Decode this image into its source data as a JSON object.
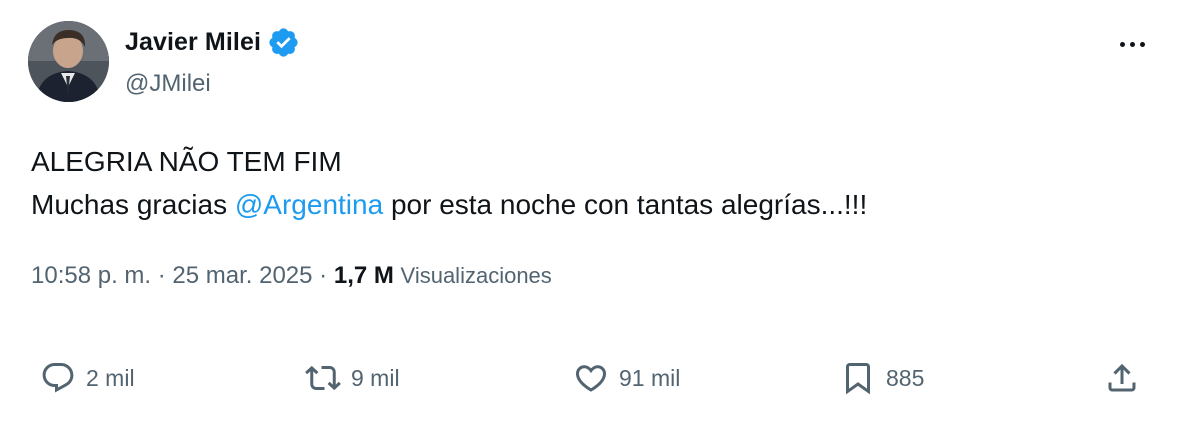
{
  "author": {
    "display_name": "Javier Milei",
    "handle": "@JMilei",
    "verified": true,
    "verified_color": "#1d9bf0"
  },
  "tweet": {
    "line1": "ALEGRIA NÃO TEM FIM",
    "line2_before": "Muchas gracias ",
    "mention": "@Argentina",
    "line2_after": " por esta noche con tantas alegrías...!!!",
    "mention_color": "#1d9bf0"
  },
  "meta": {
    "time": "10:58 p. m.",
    "separator1": " · ",
    "date": "25 mar. 2025",
    "separator2": " · ",
    "views_count": "1,7 M",
    "views_label": "Visualizaciones"
  },
  "actions": {
    "replies": "2 mil",
    "reposts": "9 mil",
    "likes": "91 mil",
    "bookmarks": "885"
  },
  "icons": {
    "reply": "reply-icon",
    "repost": "repost-icon",
    "like": "heart-icon",
    "bookmark": "bookmark-icon",
    "share": "share-icon",
    "more": "more-icon",
    "verified": "verified-badge-icon"
  }
}
